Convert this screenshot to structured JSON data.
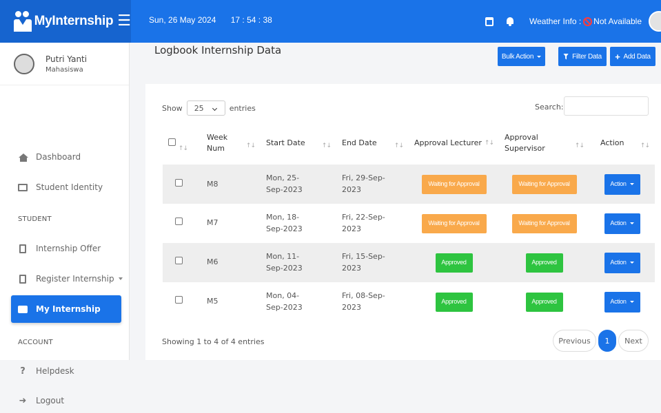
{
  "brand": {
    "name": "MyInternship"
  },
  "topbar": {
    "date": "Sun, 26 May 2024",
    "time": "17 : 54 : 38",
    "weather_label": "Weather Info :",
    "weather_value": "Not Available"
  },
  "profile": {
    "name": "Putri Yanti",
    "role": "Mahasiswa"
  },
  "menu": {
    "dashboard": "Dashboard",
    "student_identity": "Student Identity",
    "section_student": "STUDENT",
    "internship_offer": "Internship Offer",
    "register_internship": "Register Internship",
    "my_internship": "My Internship",
    "section_account": "ACCOUNT",
    "helpdesk": "Helpdesk",
    "logout": "Logout"
  },
  "page": {
    "title": "Logbook Internship Data",
    "bulk_action": "Bulk Action",
    "filter_data": "Filter Data",
    "add_data": "Add Data"
  },
  "table_controls": {
    "show_label": "Show",
    "entries_value": "25",
    "entries_label": "entries",
    "search_label": "Search:"
  },
  "table": {
    "columns": [
      "Week Num",
      "Start Date",
      "End Date",
      "Approval Lecturer",
      "Approval Supervisor",
      "Action"
    ],
    "rows": [
      {
        "week": "M8",
        "start": "Mon, 25-Sep-2023",
        "end": "Fri, 29-Sep-2023",
        "lecturer": "Waiting for Approval",
        "supervisor": "Waiting for Approval",
        "action": "Action"
      },
      {
        "week": "M7",
        "start": "Mon, 18-Sep-2023",
        "end": "Fri, 22-Sep-2023",
        "lecturer": "Waiting for Approval",
        "supervisor": "Waiting for Approval",
        "action": "Action"
      },
      {
        "week": "M6",
        "start": "Mon, 11-Sep-2023",
        "end": "Fri, 15-Sep-2023",
        "lecturer": "Approved",
        "supervisor": "Approved",
        "action": "Action"
      },
      {
        "week": "M5",
        "start": "Mon, 04-Sep-2023",
        "end": "Fri, 08-Sep-2023",
        "lecturer": "Approved",
        "supervisor": "Approved",
        "action": "Action"
      }
    ]
  },
  "footer": {
    "info": "Showing 1 to 4 of 4 entries",
    "previous": "Previous",
    "page": "1",
    "next": "Next"
  },
  "colors": {
    "primary": "#1a73e8",
    "waiting": "#f9a94b",
    "approved": "#2ec440"
  }
}
